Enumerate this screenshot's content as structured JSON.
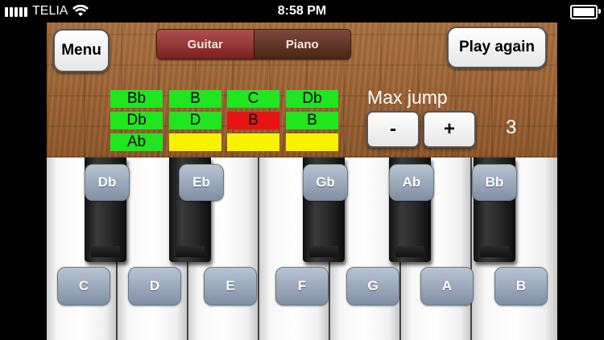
{
  "status_bar": {
    "carrier": "TELIA",
    "time": "8:58 PM"
  },
  "header": {
    "menu_label": "Menu",
    "play_again_label": "Play again",
    "mode_tabs": [
      {
        "label": "Guitar",
        "selected": true
      },
      {
        "label": "Piano",
        "selected": false
      }
    ]
  },
  "note_grid": {
    "rows": [
      [
        {
          "text": "Bb",
          "color": "#1fe61f"
        },
        {
          "text": "B",
          "color": "#1fe61f"
        },
        {
          "text": "C",
          "color": "#1fe61f"
        },
        {
          "text": "Db",
          "color": "#1fe61f"
        }
      ],
      [
        {
          "text": "Db",
          "color": "#1fe61f"
        },
        {
          "text": "D",
          "color": "#1fe61f"
        },
        {
          "text": "B",
          "color": "#e81414"
        },
        {
          "text": "B",
          "color": "#1fe61f"
        }
      ],
      [
        {
          "text": "Ab",
          "color": "#1fe61f"
        },
        {
          "text": "",
          "color": "#f8f200"
        },
        {
          "text": "",
          "color": "#f8f200"
        },
        {
          "text": "",
          "color": "#f8f200"
        }
      ]
    ]
  },
  "max_jump": {
    "label": "Max jump",
    "minus_label": "-",
    "plus_label": "+",
    "value": "3"
  },
  "keyboard": {
    "black_keys": [
      "Db",
      "Eb",
      "Gb",
      "Ab",
      "Bb"
    ],
    "white_keys": [
      "C",
      "D",
      "E",
      "F",
      "G",
      "A",
      "B"
    ]
  }
}
